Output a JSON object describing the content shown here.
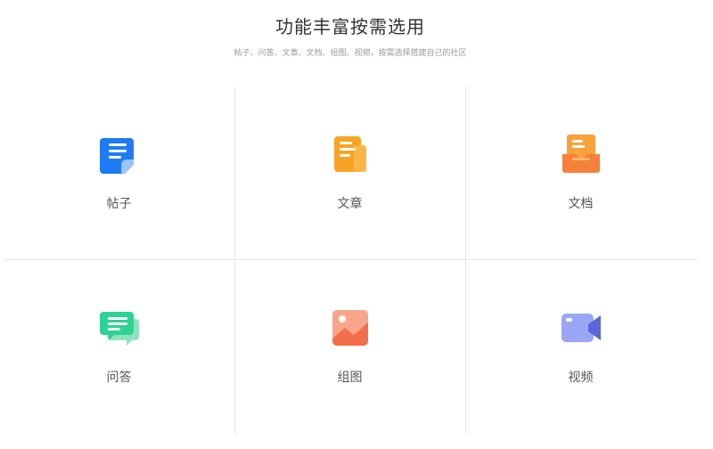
{
  "header": {
    "title": "功能丰富按需选用",
    "subtitle": "帖子、问答、文章、文档、组图、视频，按需选择搭建自己的社区"
  },
  "features": [
    {
      "label": "帖子",
      "icon": "post-icon",
      "color": "#1e7bf5"
    },
    {
      "label": "文章",
      "icon": "article-icon",
      "color": "#f7a326"
    },
    {
      "label": "文档",
      "icon": "document-icon",
      "color": "#f78a2c"
    },
    {
      "label": "问答",
      "icon": "qa-icon",
      "color": "#2ed293"
    },
    {
      "label": "组图",
      "icon": "gallery-icon",
      "color": "#f47a57"
    },
    {
      "label": "视频",
      "icon": "video-icon",
      "color": "#6f7eea"
    }
  ]
}
